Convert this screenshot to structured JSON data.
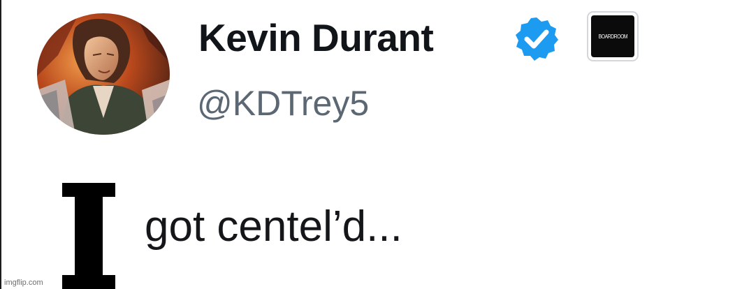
{
  "tweet": {
    "author": {
      "display_name": "Kevin Durant",
      "handle": "@KDTrey5",
      "avatar_icon": "profile-avatar",
      "verified_icon": "verified-badge-icon",
      "verified_color": "#1d9bf0",
      "affiliate_badge_text": "BOARDROOM"
    },
    "text": "got centel’d..."
  },
  "meme": {
    "caption_letter": "I",
    "watermark": "imgflip.com"
  },
  "colors": {
    "name": "#111418",
    "handle": "#5b6773",
    "text": "#141619",
    "background": "#ffffff"
  }
}
